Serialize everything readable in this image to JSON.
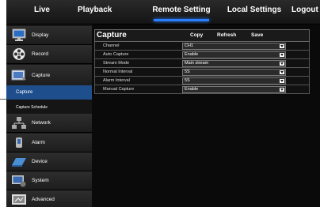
{
  "topnav": {
    "tabs": [
      {
        "label": "Live"
      },
      {
        "label": "Playback"
      },
      {
        "label": "Remote Setting"
      },
      {
        "label": "Local Settings"
      },
      {
        "label": "Logout"
      }
    ]
  },
  "sidebar": {
    "items": [
      {
        "label": "Display",
        "icon": "monitor-icon"
      },
      {
        "label": "Record",
        "icon": "film-reel-icon"
      },
      {
        "label": "Capture",
        "icon": "capture-icon"
      },
      {
        "label": "Network",
        "icon": "network-icon"
      },
      {
        "label": "Alarm",
        "icon": "alarm-icon"
      },
      {
        "label": "Device",
        "icon": "device-icon"
      },
      {
        "label": "System",
        "icon": "system-icon"
      },
      {
        "label": "Advanced",
        "icon": "advanced-icon"
      }
    ],
    "subitems": [
      {
        "label": "Capture"
      },
      {
        "label": "Capture Schedule"
      }
    ]
  },
  "panel": {
    "title": "Capture",
    "copy_label": "Copy",
    "refresh_label": "Refresh",
    "save_label": "Save",
    "rows": [
      {
        "label": "Channel",
        "value": "CH1"
      },
      {
        "label": "Auto Capture",
        "value": "Enable"
      },
      {
        "label": "Stream Mode",
        "value": "Main stream"
      },
      {
        "label": "Normal Interval",
        "value": "5S"
      },
      {
        "label": "Alarm Interval",
        "value": "5S"
      },
      {
        "label": "Manual Capture",
        "value": "Enable"
      }
    ]
  },
  "colors": {
    "accent": "#2a7fff",
    "selected": "#1e4e8c",
    "background": "#0a0a0a"
  }
}
